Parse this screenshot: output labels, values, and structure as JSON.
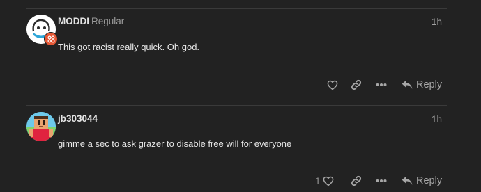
{
  "posts": [
    {
      "username": "MODDI",
      "user_title": "Regular",
      "age": "1h",
      "text": "This got racist really quick. Oh god.",
      "like_count": "",
      "reply_label": "Reply",
      "avatar_icon": "ghost-avatar-with-flair-badge"
    },
    {
      "username": "jb303044",
      "user_title": "",
      "age": "1h",
      "text": "gimme a sec to ask grazer to disable free will for everyone",
      "like_count": "1",
      "reply_label": "Reply",
      "avatar_icon": "pixel-character-avatar"
    }
  ],
  "colors": {
    "background": "#222222",
    "text": "#dddddd",
    "muted": "#a7a7a7",
    "flair": "#e45735"
  }
}
